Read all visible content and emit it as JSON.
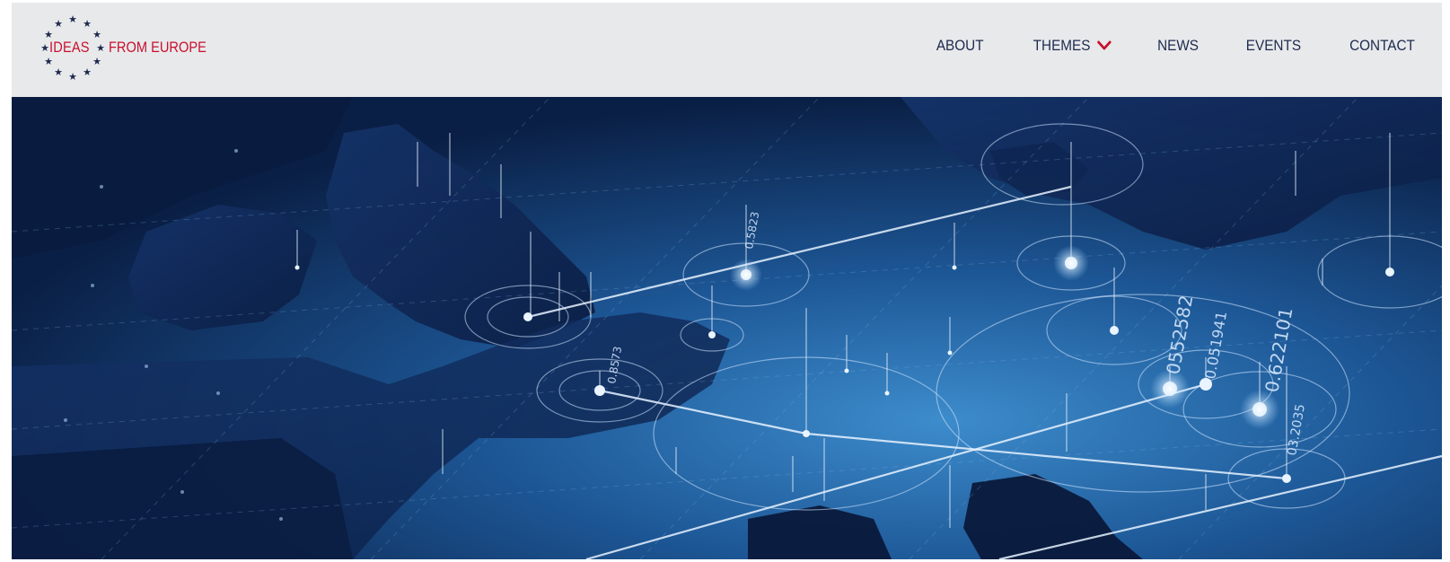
{
  "brand": {
    "logo_left": "IDEAS",
    "logo_right": "FROM EUROPE",
    "accent_color": "#c8102e",
    "star_color": "#1d2a4d"
  },
  "nav": {
    "items": [
      {
        "label": "ABOUT",
        "has_dropdown": false
      },
      {
        "label": "THEMES",
        "has_dropdown": true,
        "icon": "chevron-down-icon"
      },
      {
        "label": "NEWS",
        "has_dropdown": false
      },
      {
        "label": "EVENTS",
        "has_dropdown": false
      },
      {
        "label": "CONTACT",
        "has_dropdown": false
      }
    ]
  },
  "hero": {
    "image": "europe-network-map",
    "map_labels": [
      "0552582",
      "0.051941",
      "0.622101",
      "0.8573",
      "0.5823",
      "03.2035"
    ]
  }
}
